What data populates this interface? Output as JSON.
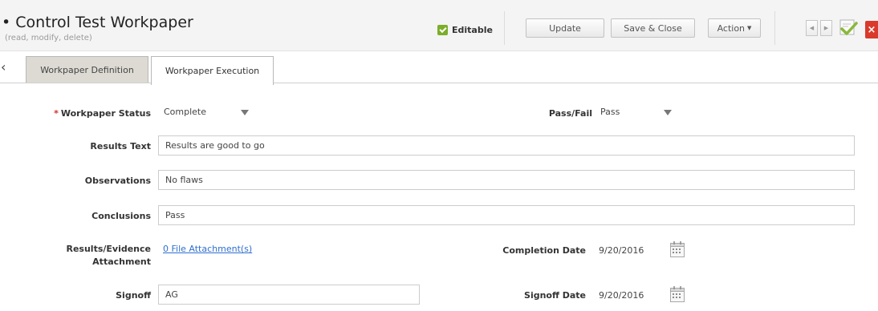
{
  "header": {
    "title": "Control Test Workpaper",
    "title_marker": "•",
    "subtitle": "(read, modify, delete)",
    "editable_label": "Editable",
    "buttons": {
      "update": "Update",
      "save_close": "Save & Close",
      "action": "Action"
    },
    "close_glyph": "×",
    "icons": [
      "checkbox-checked-icon",
      "prev-arrow-icon",
      "next-arrow-icon",
      "approve-checkmark-icon",
      "close-icon"
    ]
  },
  "tabs": [
    {
      "label": "Workpaper Definition",
      "active": false
    },
    {
      "label": "Workpaper Execution",
      "active": true
    }
  ],
  "form": {
    "required_marker": "*",
    "workpaper_status": {
      "label": "Workpaper Status",
      "value": "Complete"
    },
    "pass_fail": {
      "label": "Pass/Fail",
      "value": "Pass"
    },
    "results_text": {
      "label": "Results Text",
      "value": "Results are good to go"
    },
    "observations": {
      "label": "Observations",
      "value": "No flaws"
    },
    "conclusions": {
      "label": "Conclusions",
      "value": "Pass"
    },
    "attachment": {
      "label": "Results/Evidence Attachment",
      "link": "0 File Attachment(s)"
    },
    "completion_date": {
      "label": "Completion Date",
      "value": "9/20/2016"
    },
    "signoff": {
      "label": "Signoff",
      "value": "AG"
    },
    "signoff_date": {
      "label": "Signoff Date",
      "value": "9/20/2016"
    }
  },
  "colors": {
    "header_bg": "#f4f4f4",
    "accent_green": "#7cae2a",
    "close_red": "#d93a2b",
    "link_blue": "#2f6fcf",
    "required_red": "#d32f2f"
  }
}
